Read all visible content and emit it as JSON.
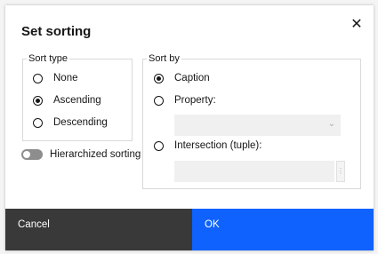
{
  "dialog": {
    "title": "Set sorting",
    "close_icon": "close-icon"
  },
  "sort_type": {
    "legend": "Sort type",
    "options": [
      "None",
      "Ascending",
      "Descending"
    ],
    "selected": "Ascending"
  },
  "sort_by": {
    "legend": "Sort by",
    "caption_label": "Caption",
    "property_label": "Property:",
    "property_value": "",
    "intersection_label": "Intersection (tuple):",
    "intersection_value": "",
    "selected": "Caption"
  },
  "hierarchized": {
    "label": "Hierarchized sorting",
    "enabled": false
  },
  "footer": {
    "cancel_label": "Cancel",
    "ok_label": "OK"
  },
  "colors": {
    "primary": "#0f62fe",
    "secondary": "#393939"
  }
}
